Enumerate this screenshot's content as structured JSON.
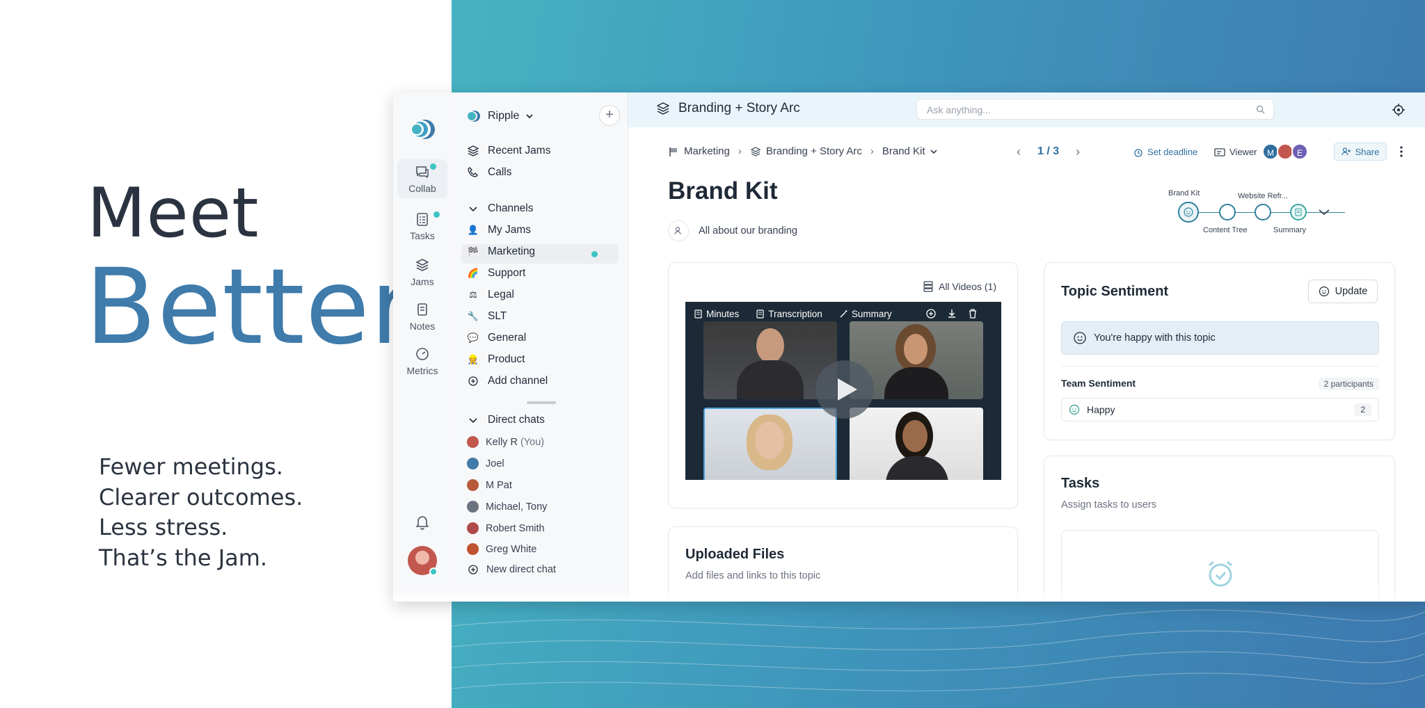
{
  "hero": {
    "meet": "Meet",
    "better": "Better",
    "lines": [
      "Fewer meetings.",
      "Clearer outcomes.",
      "Less stress.",
      "That’s the Jam."
    ]
  },
  "rail": {
    "items": [
      {
        "label": "Collab",
        "icon": "chat-icon",
        "active": true,
        "badge": true
      },
      {
        "label": "Tasks",
        "icon": "checklist-icon",
        "badge": true
      },
      {
        "label": "Jams",
        "icon": "layers-icon"
      },
      {
        "label": "Notes",
        "icon": "notes-icon"
      },
      {
        "label": "Metrics",
        "icon": "gauge-icon"
      }
    ]
  },
  "sidebar": {
    "workspace": "Ripple",
    "recent": "Recent Jams",
    "calls": "Calls",
    "channels_header": "Channels",
    "channels": [
      {
        "label": "My Jams",
        "emoji": "👤"
      },
      {
        "label": "Marketing",
        "emoji": "🏁"
      },
      {
        "label": "Support",
        "emoji": "🌈"
      },
      {
        "label": "Legal",
        "emoji": "⚖"
      },
      {
        "label": "SLT",
        "emoji": "🔧"
      },
      {
        "label": "General",
        "emoji": "💬"
      },
      {
        "label": "Product",
        "emoji": "👷"
      }
    ],
    "add_channel": "Add channel",
    "dm_header": "Direct chats",
    "dms": [
      {
        "label": "Kelly R",
        "suffix": "(You)",
        "color": "#c2574e"
      },
      {
        "label": "Joel",
        "suffix": "",
        "color": "#3f7bab"
      },
      {
        "label": "M Pat",
        "suffix": "",
        "color": "#b65a3a"
      },
      {
        "label": "Michael, Tony",
        "suffix": "",
        "color": "#6b7280"
      },
      {
        "label": "Robert Smith",
        "suffix": "",
        "color": "#b04a4a"
      },
      {
        "label": "Greg White",
        "suffix": "",
        "color": "#c0522f"
      }
    ],
    "new_dm": "New direct chat"
  },
  "topbar": {
    "title": "Branding + Story Arc",
    "search_placeholder": "Ask anything..."
  },
  "crumbs": {
    "c1": "Marketing",
    "c2": "Branding + Story Arc",
    "c3": "Brand Kit",
    "page": "1 / 3",
    "deadline": "Set deadline",
    "viewer": "Viewer",
    "avatars": [
      {
        "initial": "M",
        "color": "#2f6f9f"
      },
      {
        "initial": "",
        "color": "#c2574e"
      },
      {
        "initial": "E",
        "color": "#6f5fb5"
      }
    ],
    "share": "Share"
  },
  "page": {
    "title": "Brand Kit",
    "description": "All about our branding"
  },
  "stepper": {
    "labels_top": [
      "Brand Kit",
      "Website Refr..."
    ],
    "labels_bottom": [
      "Content Tree",
      "Summary"
    ]
  },
  "video": {
    "all_videos": "All Videos (1)",
    "toolbar": [
      "Minutes",
      "Transcription",
      "Summary"
    ]
  },
  "files": {
    "title": "Uploaded Files",
    "subtitle": "Add files and links to this topic"
  },
  "sentiment": {
    "title": "Topic Sentiment",
    "update": "Update",
    "banner": "You're happy with this topic",
    "team_label": "Team Sentiment",
    "participants": "2 participants",
    "happy_label": "Happy",
    "happy_count": "2"
  },
  "tasks": {
    "title": "Tasks",
    "subtitle": "Assign tasks to users"
  },
  "colors": {
    "accent": "#3f7bab",
    "teal": "#3cc4c4",
    "heading": "#2b3340"
  }
}
